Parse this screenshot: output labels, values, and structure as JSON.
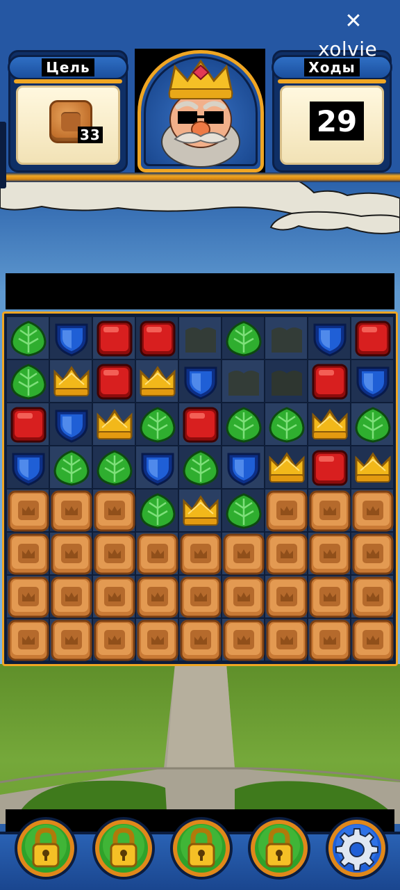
{
  "hud": {
    "goal_title": "Цель",
    "goal_count": "33",
    "moves_title": "Ходы",
    "moves_count": "29"
  },
  "brand": {
    "name": "xolvie",
    "icon": "xolvie-logo-icon"
  },
  "colors": {
    "leaf": "#2fae2f",
    "shield": "#1f5fd6",
    "cube": "#d81f1f",
    "crown": "#f2b81a",
    "crate": "#c97a35",
    "frame_gold": "#f0a623",
    "hud_blue": "#2557a3"
  },
  "board": {
    "columns": 9,
    "rows": 8,
    "legend": {
      "L": "leaf-gem",
      "S": "shield-gem",
      "R": "red-cube-gem",
      "C": "crown-gem",
      "B": "wooden-crate-blocker",
      "E": "empty-cell"
    },
    "grid": [
      [
        "L",
        "S",
        "R",
        "R",
        "E",
        "L",
        "E",
        "S",
        "R"
      ],
      [
        "L",
        "C",
        "R",
        "C",
        "S",
        "E",
        "E",
        "R",
        "S"
      ],
      [
        "R",
        "S",
        "C",
        "L",
        "R",
        "L",
        "L",
        "C",
        "L"
      ],
      [
        "S",
        "L",
        "L",
        "S",
        "L",
        "S",
        "C",
        "R",
        "C"
      ],
      [
        "B",
        "B",
        "B",
        "L",
        "C",
        "L",
        "B",
        "B",
        "B"
      ],
      [
        "B",
        "B",
        "B",
        "B",
        "B",
        "B",
        "B",
        "B",
        "B"
      ],
      [
        "B",
        "B",
        "B",
        "B",
        "B",
        "B",
        "B",
        "B",
        "B"
      ],
      [
        "B",
        "B",
        "B",
        "B",
        "B",
        "B",
        "B",
        "B",
        "B"
      ]
    ]
  },
  "boosters": [
    {
      "icon": "lock-icon",
      "locked": true
    },
    {
      "icon": "lock-icon",
      "locked": true
    },
    {
      "icon": "lock-icon",
      "locked": true
    },
    {
      "icon": "lock-icon",
      "locked": true
    },
    {
      "icon": "gear-icon",
      "locked": false
    }
  ]
}
